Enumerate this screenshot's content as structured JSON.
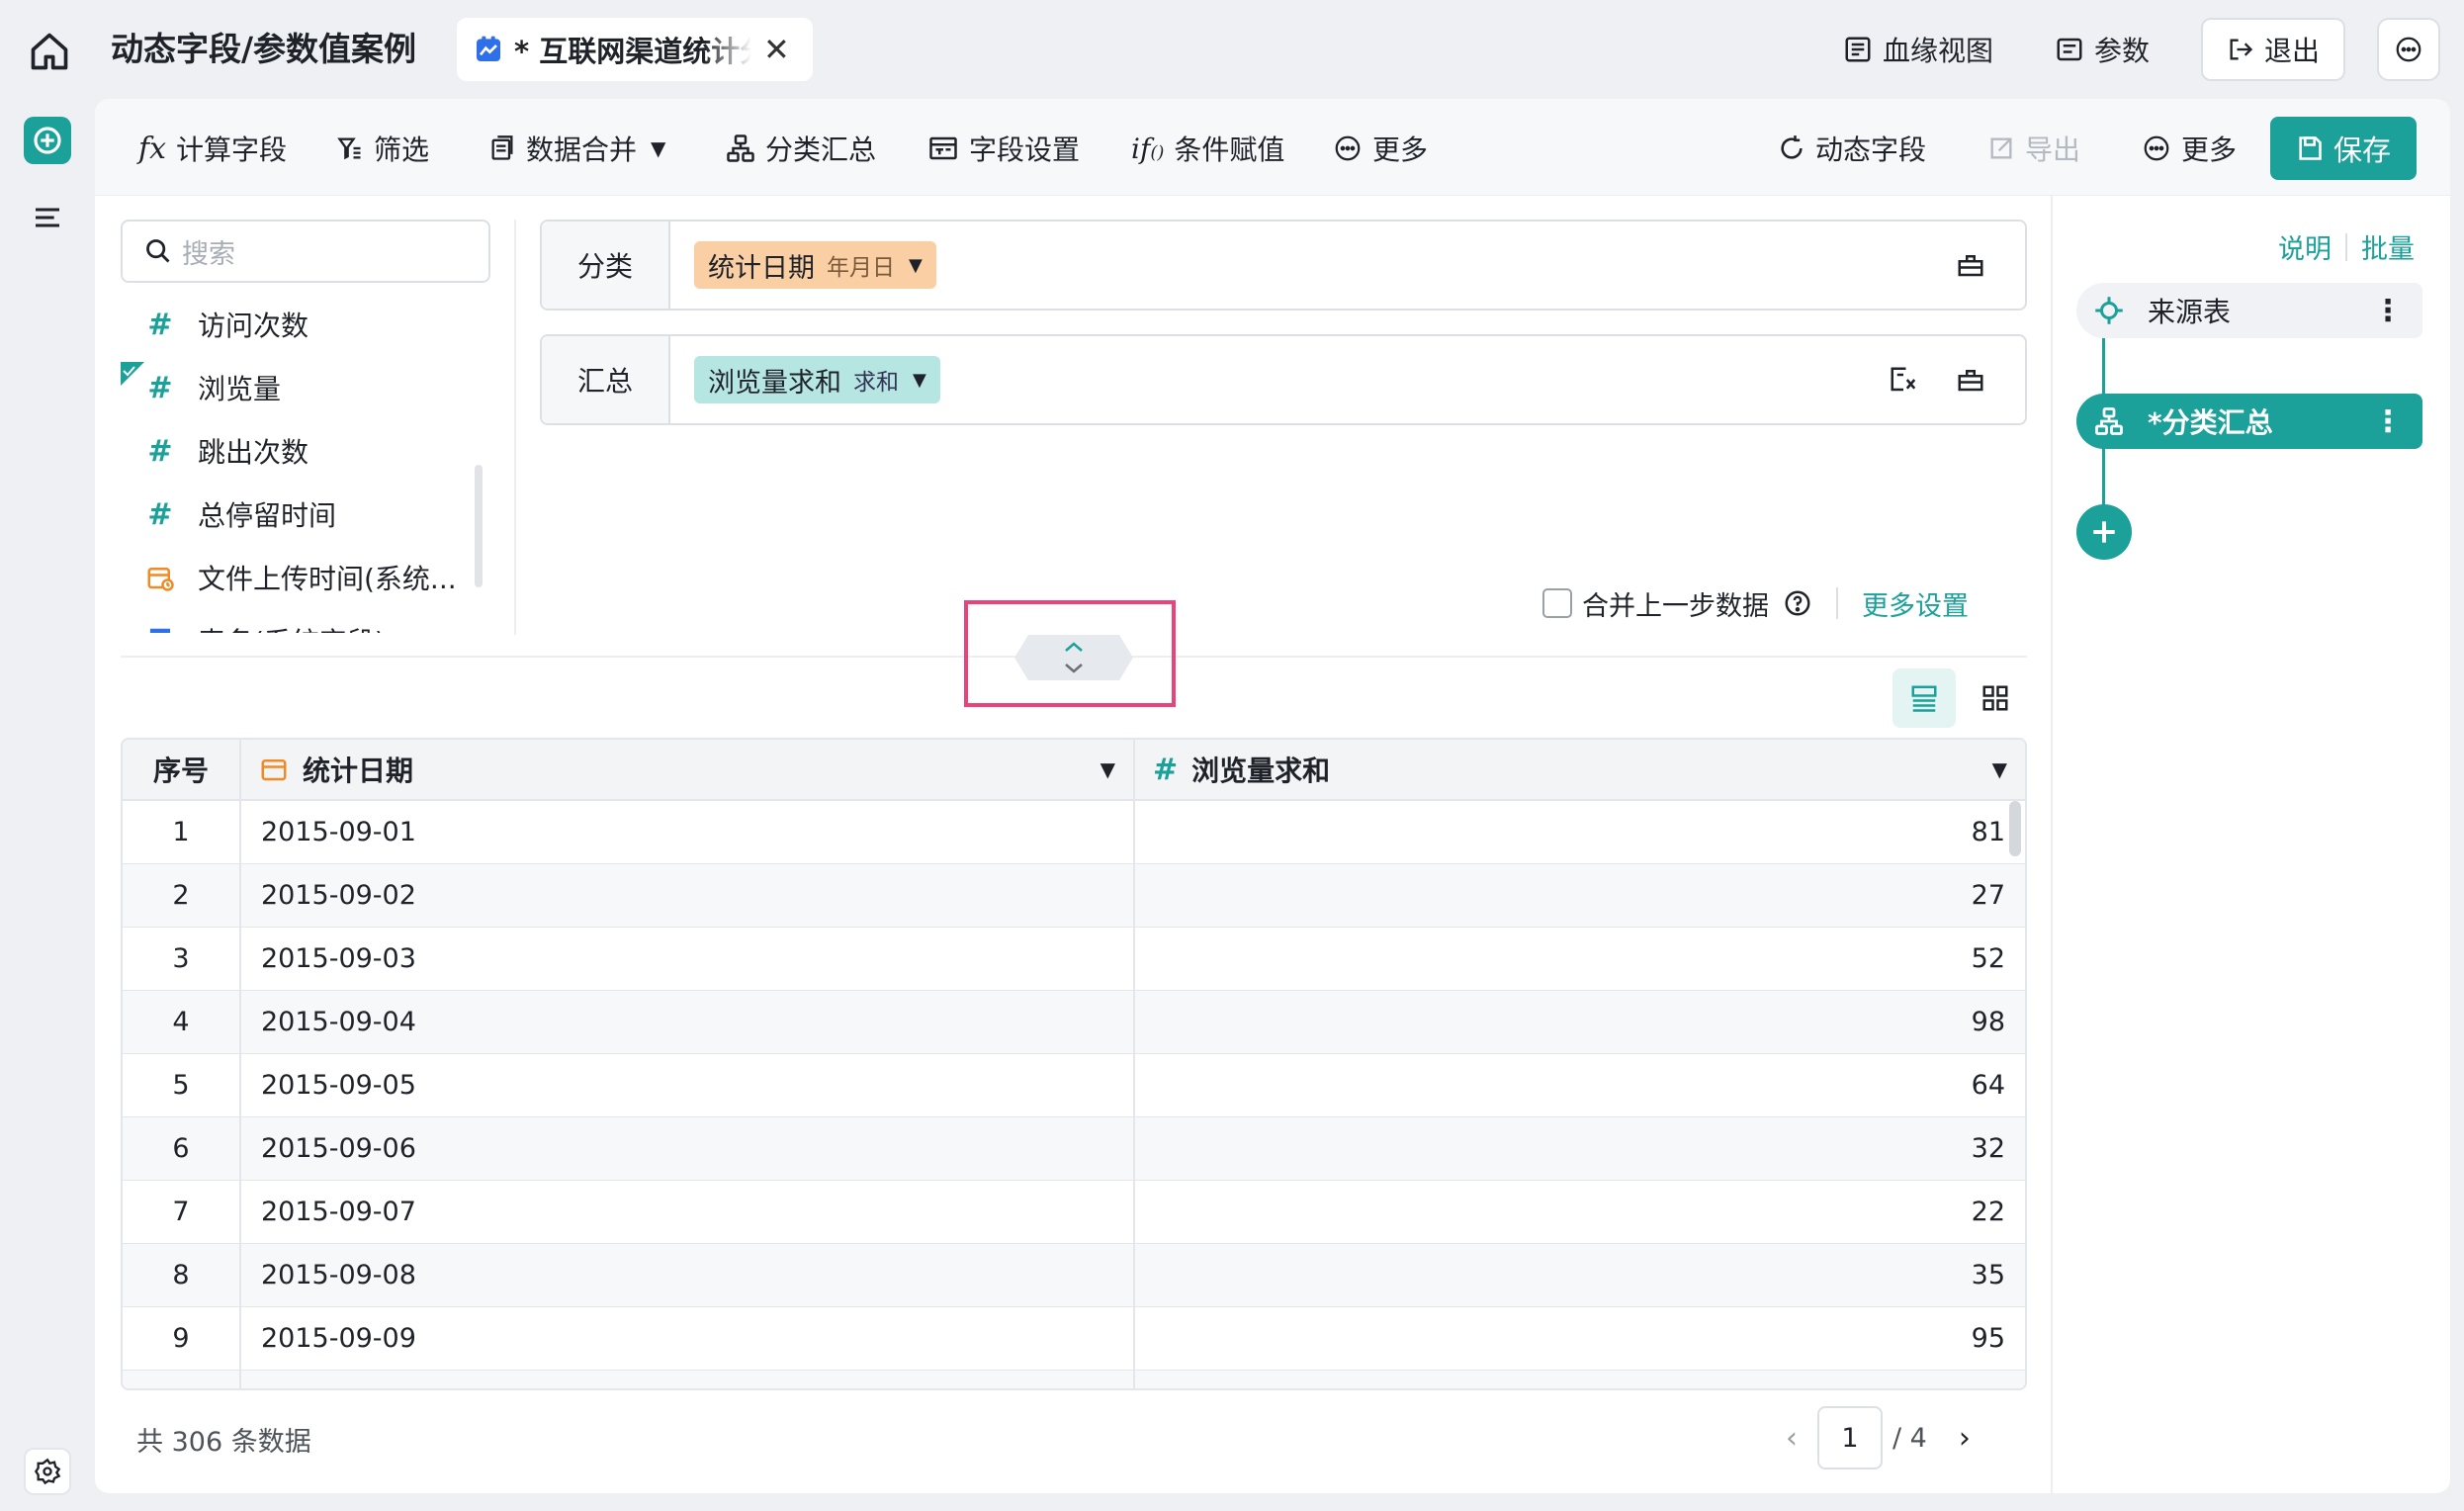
{
  "header": {
    "breadcrumb": "动态字段/参数值案例",
    "tab_label": "* 互联网渠道统计分",
    "tab_close": "✕",
    "lineage_label": "血缘视图",
    "params_label": "参数",
    "exit_label": "退出"
  },
  "toolbar": {
    "calc_field": "计算字段",
    "filter": "筛选",
    "merge": "数据合并",
    "group_summary": "分类汇总",
    "field_settings": "字段设置",
    "conditional_assign": "条件赋值",
    "more": "更多",
    "dynamic_field": "动态字段",
    "export": "导出",
    "more_right": "更多",
    "save": "保存"
  },
  "field_panel": {
    "search_placeholder": "搜索",
    "items": [
      {
        "label": "访问次数",
        "icon": "#"
      },
      {
        "label": "浏览量",
        "icon": "#"
      },
      {
        "label": "跳出次数",
        "icon": "#"
      },
      {
        "label": "总停留时间",
        "icon": "#"
      },
      {
        "label": "文件上传时间(系统...",
        "icon": "date"
      },
      {
        "label": "表名(系统字段)",
        "icon": "T"
      }
    ]
  },
  "config": {
    "group_label": "分类",
    "group_chip": "统计日期",
    "group_chip_sub": "年月日",
    "summary_label": "汇总",
    "summary_chip": "浏览量求和",
    "summary_chip_sub": "求和",
    "merge_prev": "合并上一步数据",
    "more_settings": "更多设置"
  },
  "table": {
    "headers": {
      "idx": "序号",
      "date": "统计日期",
      "value": "浏览量求和"
    },
    "rows": [
      {
        "idx": "1",
        "date": "2015-09-01",
        "value": "81"
      },
      {
        "idx": "2",
        "date": "2015-09-02",
        "value": "27"
      },
      {
        "idx": "3",
        "date": "2015-09-03",
        "value": "52"
      },
      {
        "idx": "4",
        "date": "2015-09-04",
        "value": "98"
      },
      {
        "idx": "5",
        "date": "2015-09-05",
        "value": "64"
      },
      {
        "idx": "6",
        "date": "2015-09-06",
        "value": "32"
      },
      {
        "idx": "7",
        "date": "2015-09-07",
        "value": "22"
      },
      {
        "idx": "8",
        "date": "2015-09-08",
        "value": "35"
      },
      {
        "idx": "9",
        "date": "2015-09-09",
        "value": "95"
      }
    ]
  },
  "footer": {
    "count": "共 306 条数据",
    "page": "1",
    "total_pages": "/ 4"
  },
  "flow": {
    "explain": "说明",
    "batch": "批量",
    "source_node": "来源表",
    "active_node": "*分类汇总"
  },
  "colors": {
    "accent": "#1ba19a",
    "highlight": "#e8447a",
    "date_chip": "#f9cfa3",
    "sum_chip": "#b6e6e2"
  }
}
